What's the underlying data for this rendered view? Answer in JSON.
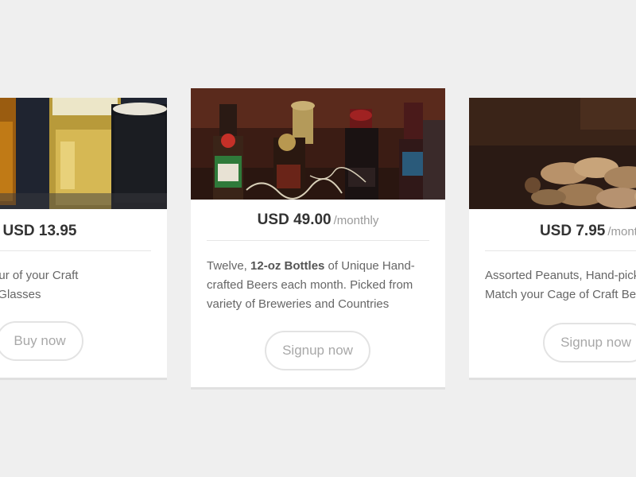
{
  "products": [
    {
      "id": "tasting-glasses",
      "image": "beer-glasses-photo",
      "price": "USD 13.95",
      "period": "",
      "description": {
        "line1": "Unique Flavour of your Craft",
        "line2": "Beer Tasting Glasses"
      },
      "button_label": "Buy now"
    },
    {
      "id": "monthly-bottles",
      "image": "beer-bottles-photo",
      "price": "USD 49.00",
      "period": "/monthly",
      "description": {
        "prefix": "Twelve, ",
        "bold": "12-oz Bottles",
        "suffix": " of Unique Hand-crafted Beers each month. Picked from variety of Breweries and Countries"
      },
      "button_label": "Signup now"
    },
    {
      "id": "peanuts",
      "image": "peanuts-photo",
      "price": "USD 7.95",
      "period": "/monthly",
      "description": {
        "line1": "Assorted Peanuts, Hand-picked to",
        "line2": "Match your Cage of Craft Beers"
      },
      "button_label": "Signup now"
    }
  ],
  "colors": {
    "background": "#efefef",
    "card": "#ffffff",
    "price_text": "#333333",
    "muted_text": "#9a9a9a",
    "body_text": "#666666",
    "button_border": "#e3e3e3"
  }
}
